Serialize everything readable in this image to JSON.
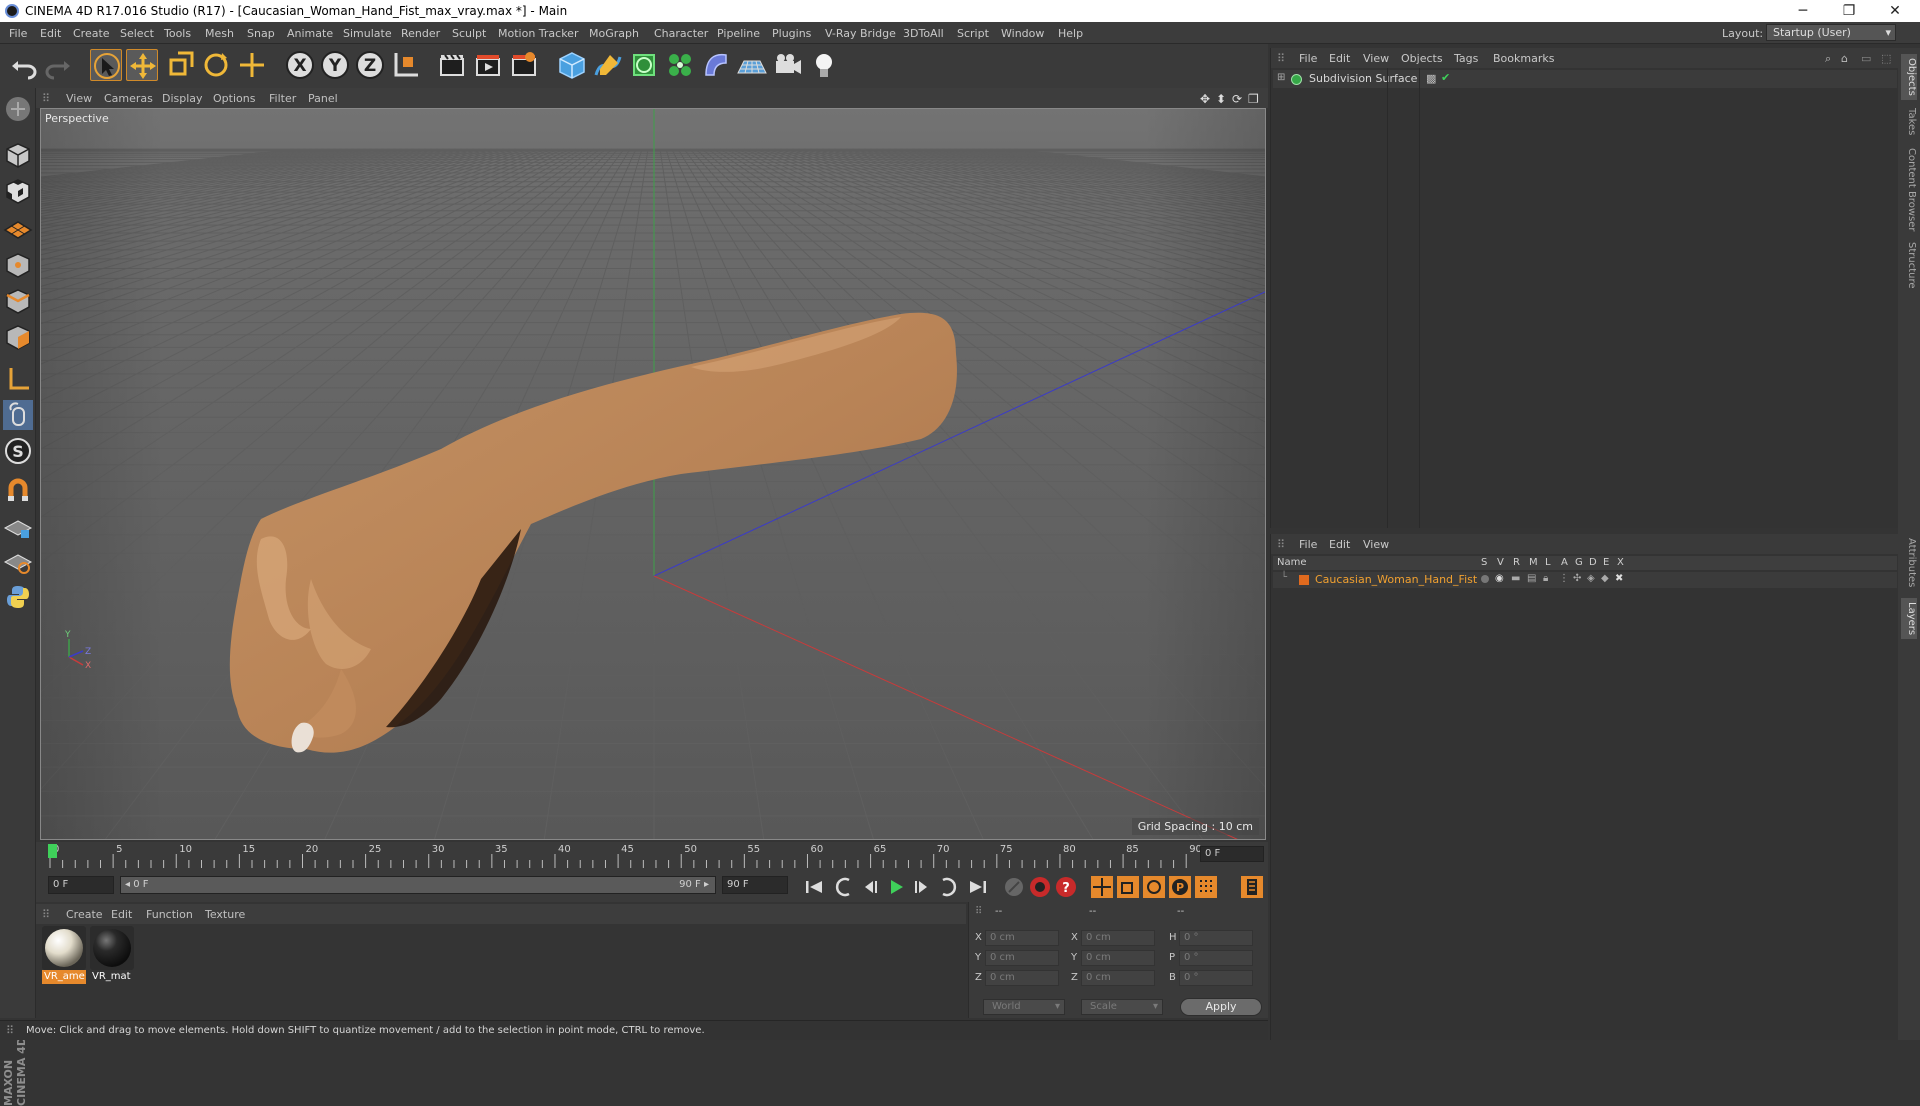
{
  "window": {
    "title": "CINEMA 4D R17.016 Studio (R17) - [Caucasian_Woman_Hand_Fist_max_vray.max *] - Main",
    "minimize": "─",
    "restore": "❐",
    "close": "✕"
  },
  "menu": [
    "File",
    "Edit",
    "Create",
    "Select",
    "Tools",
    "Mesh",
    "Snap",
    "Animate",
    "Simulate",
    "Render",
    "Sculpt",
    "Motion Tracker",
    "MoGraph",
    "Character",
    "Pipeline",
    "Plugins",
    "V-Ray Bridge",
    "3DToAll",
    "Script",
    "Window",
    "Help"
  ],
  "layout": {
    "label": "Layout:",
    "value": "Startup (User)"
  },
  "viewport": {
    "menu": [
      "View",
      "Cameras",
      "Display",
      "Options",
      "Filter",
      "Panel"
    ],
    "label": "Perspective",
    "grid_spacing": "Grid Spacing : 10 cm"
  },
  "timeline": {
    "ticks": [
      "0",
      "5",
      "10",
      "15",
      "20",
      "25",
      "30",
      "35",
      "40",
      "45",
      "50",
      "55",
      "60",
      "65",
      "70",
      "75",
      "80",
      "85",
      "90"
    ],
    "end_field": "0 F"
  },
  "transport": {
    "start_field": "0 F",
    "range_start": "◂ 0 F",
    "range_end": "90 F ▸",
    "end_field": "90 F"
  },
  "materials": {
    "menu": [
      "Create",
      "Edit",
      "Function",
      "Texture"
    ],
    "items": [
      {
        "label": "VR_ame",
        "selected": true,
        "color": "#e8e2d2"
      },
      {
        "label": "VR_mat",
        "selected": false,
        "color": "#1a1a1a"
      }
    ]
  },
  "coordinates": {
    "headers": [
      "--",
      "--",
      "--"
    ],
    "rows": [
      {
        "axis": "X",
        "pos": "0 cm",
        "size_axis": "X",
        "size": "0 cm",
        "rot_axis": "H",
        "rot": "0 °"
      },
      {
        "axis": "Y",
        "pos": "0 cm",
        "size_axis": "Y",
        "size": "0 cm",
        "rot_axis": "P",
        "rot": "0 °"
      },
      {
        "axis": "Z",
        "pos": "0 cm",
        "size_axis": "Z",
        "size": "0 cm",
        "rot_axis": "B",
        "rot": "0 °"
      }
    ],
    "space": "World",
    "mode": "Scale",
    "apply": "Apply"
  },
  "status": "Move: Click and drag to move elements. Hold down SHIFT to quantize movement / add to the selection in point mode, CTRL to remove.",
  "objects_panel": {
    "menu": [
      "File",
      "Edit",
      "View",
      "Objects",
      "Tags",
      "Bookmarks"
    ],
    "object_name": "Subdivision Surface"
  },
  "layers_panel": {
    "menu": [
      "File",
      "Edit",
      "View"
    ],
    "columns": [
      "Name",
      "S",
      "V",
      "R",
      "M",
      "L",
      "A",
      "G",
      "D",
      "E",
      "X"
    ],
    "layer_name": "Caucasian_Woman_Hand_Fist",
    "layer_color": "#e06a1e"
  },
  "side_tabs": [
    "Objects",
    "Takes",
    "Content Browser",
    "Structure",
    "Attributes",
    "Layers"
  ],
  "brand": "MAXON CINEMA 4D"
}
